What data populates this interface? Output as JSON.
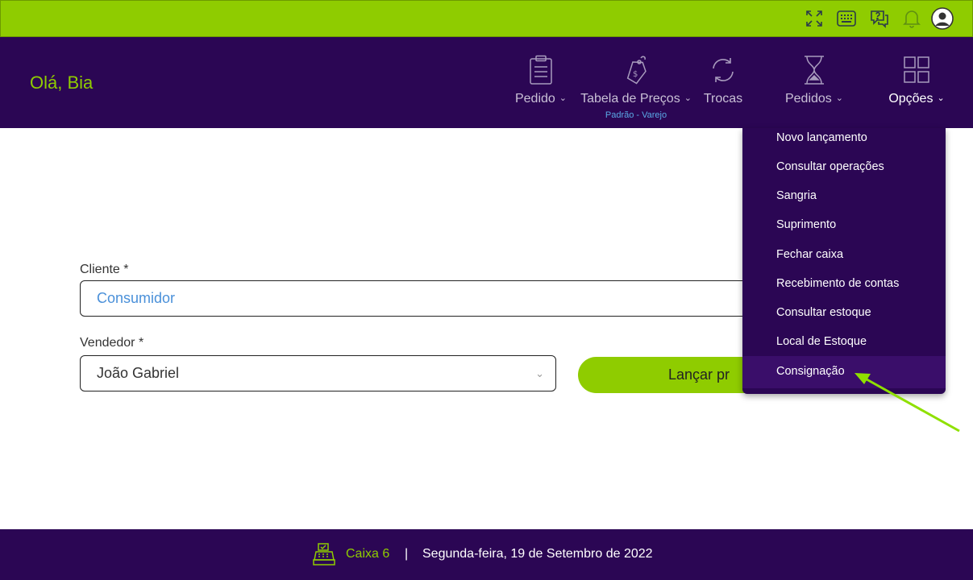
{
  "topbar": {
    "icons": [
      "fullscreen-icon",
      "keyboard-icon",
      "help-icon",
      "bell-icon",
      "user-avatar-icon"
    ],
    "color": "#8fcc00"
  },
  "header": {
    "greeting": "Olá, Bia",
    "nav": [
      {
        "label": "Pedido",
        "icon": "clipboard-icon",
        "has_dropdown": true
      },
      {
        "label": "Tabela de Preços",
        "icon": "price-tag-icon",
        "has_dropdown": true,
        "sub": "Padrão - Varejo"
      },
      {
        "label": "Trocas",
        "icon": "exchange-icon",
        "has_dropdown": false
      },
      {
        "label": "Pedidos",
        "icon": "hourglass-icon",
        "has_dropdown": true
      },
      {
        "label": "Opções",
        "icon": "grid-icon",
        "has_dropdown": true,
        "active": true
      }
    ],
    "chevron": "⌄",
    "background": "#2b0654"
  },
  "form": {
    "cliente_label": "Cliente *",
    "cliente_value": "Consumidor",
    "vendedor_label": "Vendedor *",
    "vendedor_value": "João Gabriel",
    "vendedor_caret": "⌄",
    "button_label": "Lançar pr"
  },
  "options_menu": {
    "items": [
      "Novo lançamento",
      "Consultar operações",
      "Sangria",
      "Suprimento",
      "Fechar caixa",
      "Recebimento de contas",
      "Consultar estoque",
      "Local de Estoque",
      "Consignação"
    ],
    "highlighted": "Consignação"
  },
  "footer": {
    "caixa": "Caixa 6",
    "separator": "|",
    "date": "Segunda-feira, 19 de Setembro de 2022"
  },
  "colors": {
    "accent": "#8fcc00",
    "primary": "#2b0654",
    "link": "#5aa9e6"
  }
}
